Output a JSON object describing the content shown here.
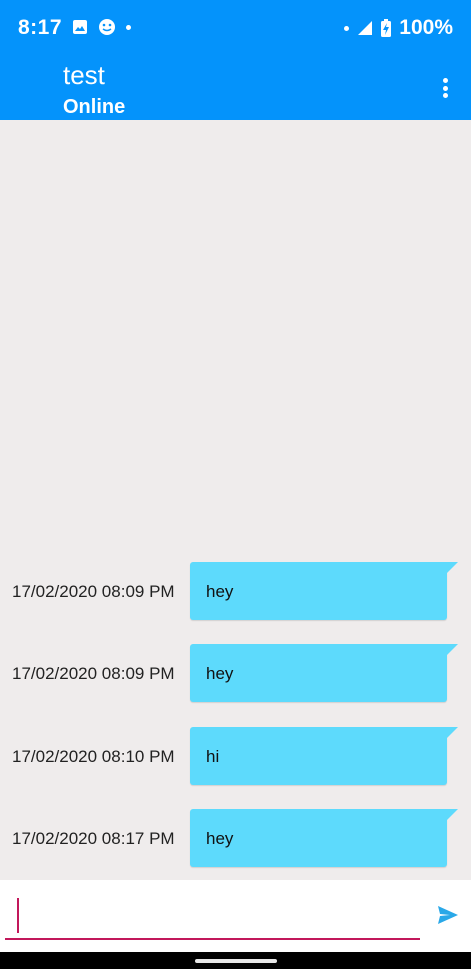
{
  "status_bar": {
    "time": "8:17",
    "battery": "100%",
    "icons": [
      "image-icon",
      "face-icon",
      "dot-icon",
      "dot-icon",
      "signal-icon",
      "battery-charging-icon"
    ]
  },
  "app_bar": {
    "title": "test",
    "subtitle": "Online",
    "menu_icon": "more-vert-icon"
  },
  "messages": [
    {
      "timestamp": "17/02/2020 08:09 PM",
      "text": "hey"
    },
    {
      "timestamp": "17/02/2020 08:09 PM",
      "text": "hey"
    },
    {
      "timestamp": "17/02/2020 08:10 PM",
      "text": "hi"
    },
    {
      "timestamp": "17/02/2020 08:17 PM",
      "text": "hey"
    }
  ],
  "composer": {
    "value": "",
    "placeholder": "",
    "send_icon": "send-icon"
  },
  "colors": {
    "primary": "#0493fb",
    "bubble": "#5ddafc",
    "background": "#efecec",
    "accent": "#c2185b"
  }
}
